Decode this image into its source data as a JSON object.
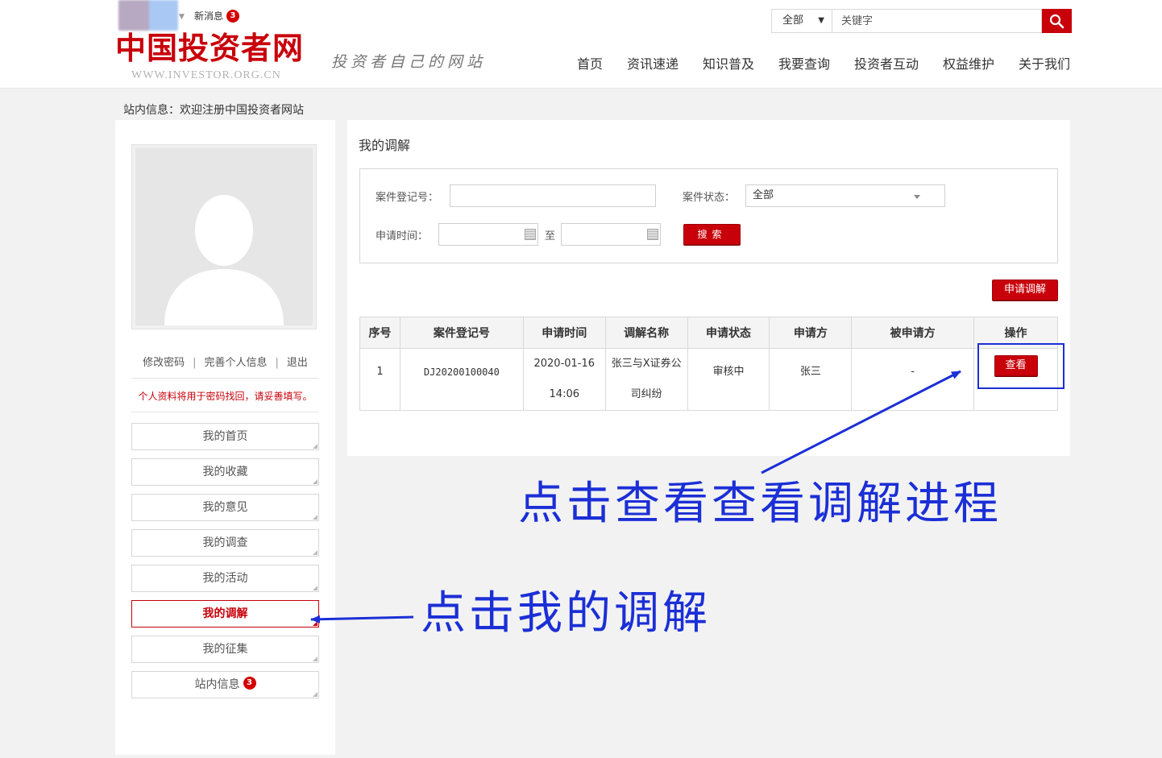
{
  "header": {
    "news_label": "新消息",
    "news_count": "3",
    "logo_text": "中国投资者网",
    "logo_url": "WWW.INVESTOR.ORG.CN",
    "slogan": "投资者自己的网站",
    "search_scope": "全部",
    "search_placeholder": "关键字",
    "nav": [
      "首页",
      "资讯速递",
      "知识普及",
      "我要查询",
      "投资者互动",
      "权益维护",
      "关于我们"
    ]
  },
  "notice": "站内信息：欢迎注册中国投资者网站",
  "sidebar": {
    "links": [
      "修改密码",
      "完善个人信息",
      "退出"
    ],
    "warning": "个人资料将用于密码找回，请妥善填写。",
    "menu": [
      "我的首页",
      "我的收藏",
      "我的意见",
      "我的调查",
      "我的活动",
      "我的调解",
      "我的征集",
      "站内信息"
    ],
    "inbox_count": "3"
  },
  "main": {
    "title": "我的调解",
    "filter": {
      "case_no_label": "案件登记号：",
      "status_label": "案件状态：",
      "status_value": "全部",
      "date_label": "申请时间：",
      "to_label": "至",
      "search_button": "搜索"
    },
    "apply_button": "申请调解",
    "table": {
      "headers": [
        "序号",
        "案件登记号",
        "申请时间",
        "调解名称",
        "申请状态",
        "申请方",
        "被申请方",
        "操作"
      ],
      "rows": [
        {
          "index": "1",
          "case_no": "DJ20200100040",
          "date": "2020-01-16",
          "time": "14:06",
          "name_line1": "张三与X证券公",
          "name_line2": "司纠纷",
          "status": "审核中",
          "applicant": "张三",
          "respondent": "-",
          "action": "查看"
        }
      ]
    }
  },
  "annotations": {
    "view_hint": "点击查看查看调解进程",
    "menu_hint": "点击我的调解"
  },
  "colors": {
    "brand_red": "#c8000a",
    "annotation_blue": "#1b2fd6",
    "page_bg": "#f2f2f2"
  }
}
